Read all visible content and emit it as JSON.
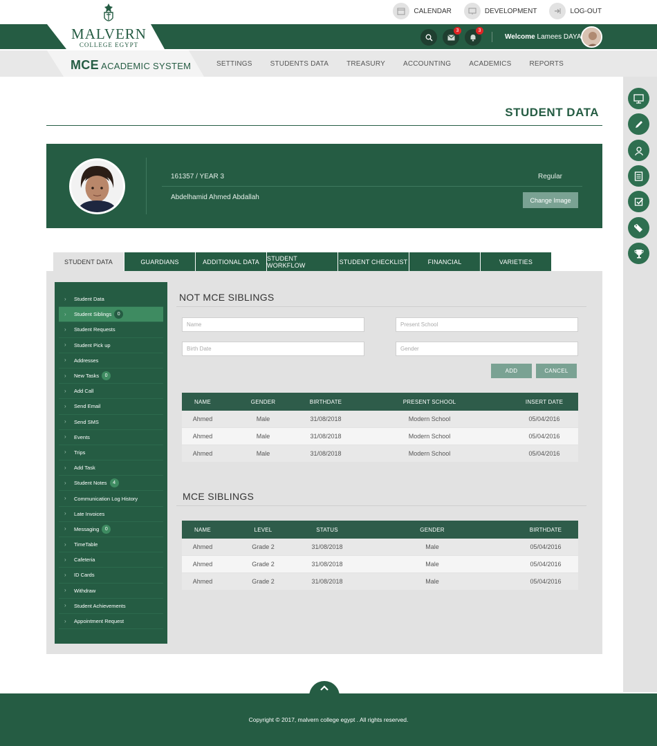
{
  "toplinks": {
    "calendar": "CALENDAR",
    "development": "DEVELOPMENT",
    "logout": "LOG-OUT"
  },
  "brand": {
    "name": "MALVERN",
    "sub": "COLLEGE EGYPT",
    "sys_bold": "MCE",
    "sys_rest": "ACADEMIC SYSTEM"
  },
  "header": {
    "messages_count": "3",
    "notifications_count": "3",
    "welcome_label": "Welcome",
    "user_name": "Lamees DAYA"
  },
  "menu": [
    "SETTINGS",
    "STUDENTS DATA",
    "TREASURY",
    "ACCOUNTING",
    "ACADEMICS",
    "REPORTS"
  ],
  "page_title": "STUDENT DATA",
  "profile": {
    "id_year": "161357 / YEAR 3",
    "type": "Regular",
    "name": "Abdelhamid Ahmed Abdallah",
    "change_image": "Change Image"
  },
  "tabs": [
    "STUDENT DATA",
    "GUARDIANS",
    "ADDITIONAL DATA",
    "STUDENT WORKFLOW",
    "STUDENT CHECKLIST",
    "FINANCIAL",
    "VARIETIES"
  ],
  "side_menu": [
    {
      "label": "Student Data",
      "count": ""
    },
    {
      "label": "Student Siblings",
      "count": "0"
    },
    {
      "label": "Student Requests",
      "count": ""
    },
    {
      "label": "Student Pick up",
      "count": ""
    },
    {
      "label": "Addresses",
      "count": ""
    },
    {
      "label": "New Tasks",
      "count": "0"
    },
    {
      "label": "Add Call",
      "count": ""
    },
    {
      "label": "Send Email",
      "count": ""
    },
    {
      "label": "Send SMS",
      "count": ""
    },
    {
      "label": "Events",
      "count": ""
    },
    {
      "label": "Trips",
      "count": ""
    },
    {
      "label": "Add Task",
      "count": ""
    },
    {
      "label": "Student Notes",
      "count": "4"
    },
    {
      "label": "Communication Log History",
      "count": ""
    },
    {
      "label": "Late Invoices",
      "count": ""
    },
    {
      "label": "Messaging",
      "count": "0"
    },
    {
      "label": "TimeTable",
      "count": ""
    },
    {
      "label": "Cafeteria",
      "count": ""
    },
    {
      "label": "ID Cards",
      "count": ""
    },
    {
      "label": "Withdraw",
      "count": ""
    },
    {
      "label": "Student Achievements",
      "count": ""
    },
    {
      "label": "Appointment Request",
      "count": ""
    }
  ],
  "not_mce": {
    "title": "NOT MCE SIBLINGS",
    "form": {
      "name_ph": "Name",
      "school_ph": "Present School",
      "birth_ph": "Birth Date",
      "gender_ph": "Gender",
      "add": "ADD",
      "cancel": "CANCEL"
    },
    "headers": [
      "NAME",
      "GENDER",
      "BIRTHDATE",
      "PRESENT SCHOOL",
      "INSERT DATE"
    ],
    "rows": [
      [
        "Ahmed",
        "Male",
        "31/08/2018",
        "Modern School",
        "05/04/2016"
      ],
      [
        "Ahmed",
        "Male",
        "31/08/2018",
        "Modern School",
        "05/04/2016"
      ],
      [
        "Ahmed",
        "Male",
        "31/08/2018",
        "Modern School",
        "05/04/2016"
      ]
    ]
  },
  "mce": {
    "title": "MCE SIBLINGS",
    "headers": [
      "NAME",
      "LEVEL",
      "STATUS",
      "GENDER",
      "BIRTHDATE"
    ],
    "rows": [
      [
        "Ahmed",
        "Grade 2",
        "31/08/2018",
        "Male",
        "05/04/2016"
      ],
      [
        "Ahmed",
        "Grade 2",
        "31/08/2018",
        "Male",
        "05/04/2016"
      ],
      [
        "Ahmed",
        "Grade 2",
        "31/08/2018",
        "Male",
        "05/04/2016"
      ]
    ]
  },
  "footer": {
    "copyright": "Copyright © 2017, malvern college egypt . All rights reserved."
  }
}
